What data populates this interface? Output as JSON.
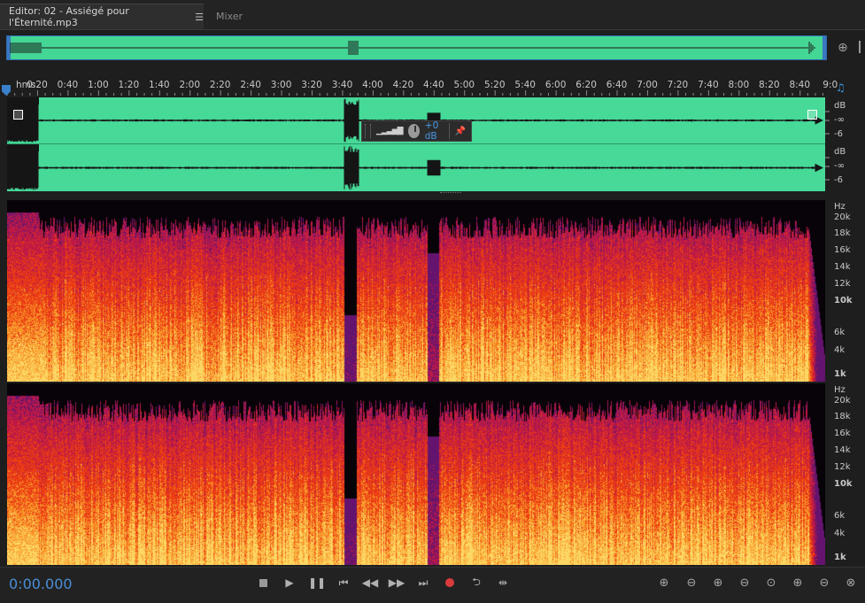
{
  "tabs": {
    "editor_label": "Editor: 02 - Assiégé pour l'Éternité.mp3",
    "editor_menu_icon": "hamburger-icon",
    "mixer_label": "Mixer"
  },
  "ruler": {
    "start_label": "hms",
    "ticks": [
      "0:20",
      "0:40",
      "1:00",
      "1:20",
      "1:40",
      "2:00",
      "2:20",
      "2:40",
      "3:00",
      "3:20",
      "3:40",
      "4:00",
      "4:20",
      "4:40",
      "5:00",
      "5:20",
      "5:40",
      "6:00",
      "6:20",
      "6:40",
      "7:00",
      "7:20",
      "7:40",
      "8:00",
      "8:20",
      "8:40",
      "9:0"
    ]
  },
  "amplitude_scale": {
    "unit": "dB",
    "top_channel": [
      "dB",
      "-∞",
      "-6"
    ],
    "bottom_channel": [
      "dB",
      "-∞",
      "-6"
    ]
  },
  "hud": {
    "gain_value": "+0 dB",
    "pin_icon": "pin-icon",
    "meter_icon": "level-meter-icon",
    "knob_icon": "gain-knob-icon"
  },
  "frequency_scale": {
    "unit": "Hz",
    "labels": [
      "20k",
      "18k",
      "16k",
      "14k",
      "12k",
      "10k",
      "6k",
      "4k",
      "1k"
    ]
  },
  "transport": {
    "timecode": "0:00.000"
  },
  "colors": {
    "waveform_bg": "#46d998",
    "accent_blue": "#4a8fd6",
    "record_red": "#d93b3b"
  }
}
